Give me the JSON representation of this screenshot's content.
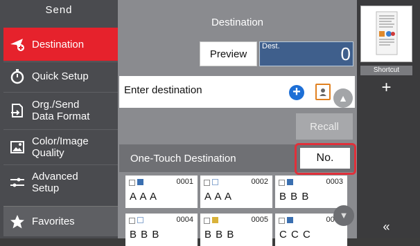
{
  "sidebar": {
    "title": "Send",
    "items": [
      {
        "label": "Destination",
        "icon": "send-destination-icon"
      },
      {
        "label": "Quick Setup",
        "icon": "stopwatch-icon"
      },
      {
        "label": "Org./Send\nData Format",
        "icon": "document-format-icon"
      },
      {
        "label": "Color/Image\nQuality",
        "icon": "image-quality-icon"
      },
      {
        "label": "Advanced\nSetup",
        "icon": "settings-sliders-icon"
      }
    ],
    "favorites": "Favorites"
  },
  "main": {
    "title": "Destination",
    "preview": "Preview",
    "dest_label": "Dest.",
    "dest_count": "0",
    "entry_label": "Enter destination",
    "recall": "Recall",
    "one_touch_label": "One-Touch Destination",
    "number_button": "No.",
    "cards": [
      {
        "num": "0001",
        "name": "A A A",
        "kind": "folder"
      },
      {
        "num": "0002",
        "name": "A A A",
        "kind": "email"
      },
      {
        "num": "0003",
        "name": "B B B",
        "kind": "folder"
      },
      {
        "num": "0004",
        "name": "B B B",
        "kind": "email"
      },
      {
        "num": "0005",
        "name": "B B B",
        "kind": "fax"
      },
      {
        "num": "0006",
        "name": "C C C",
        "kind": "folder"
      }
    ]
  },
  "right_panel": {
    "shortcut": "Shortcut",
    "add": "+",
    "collapse": "«"
  },
  "colors": {
    "accent": "#e6222c",
    "dest_box": "#3f5f8c",
    "add_icon": "#1d6fd6"
  }
}
